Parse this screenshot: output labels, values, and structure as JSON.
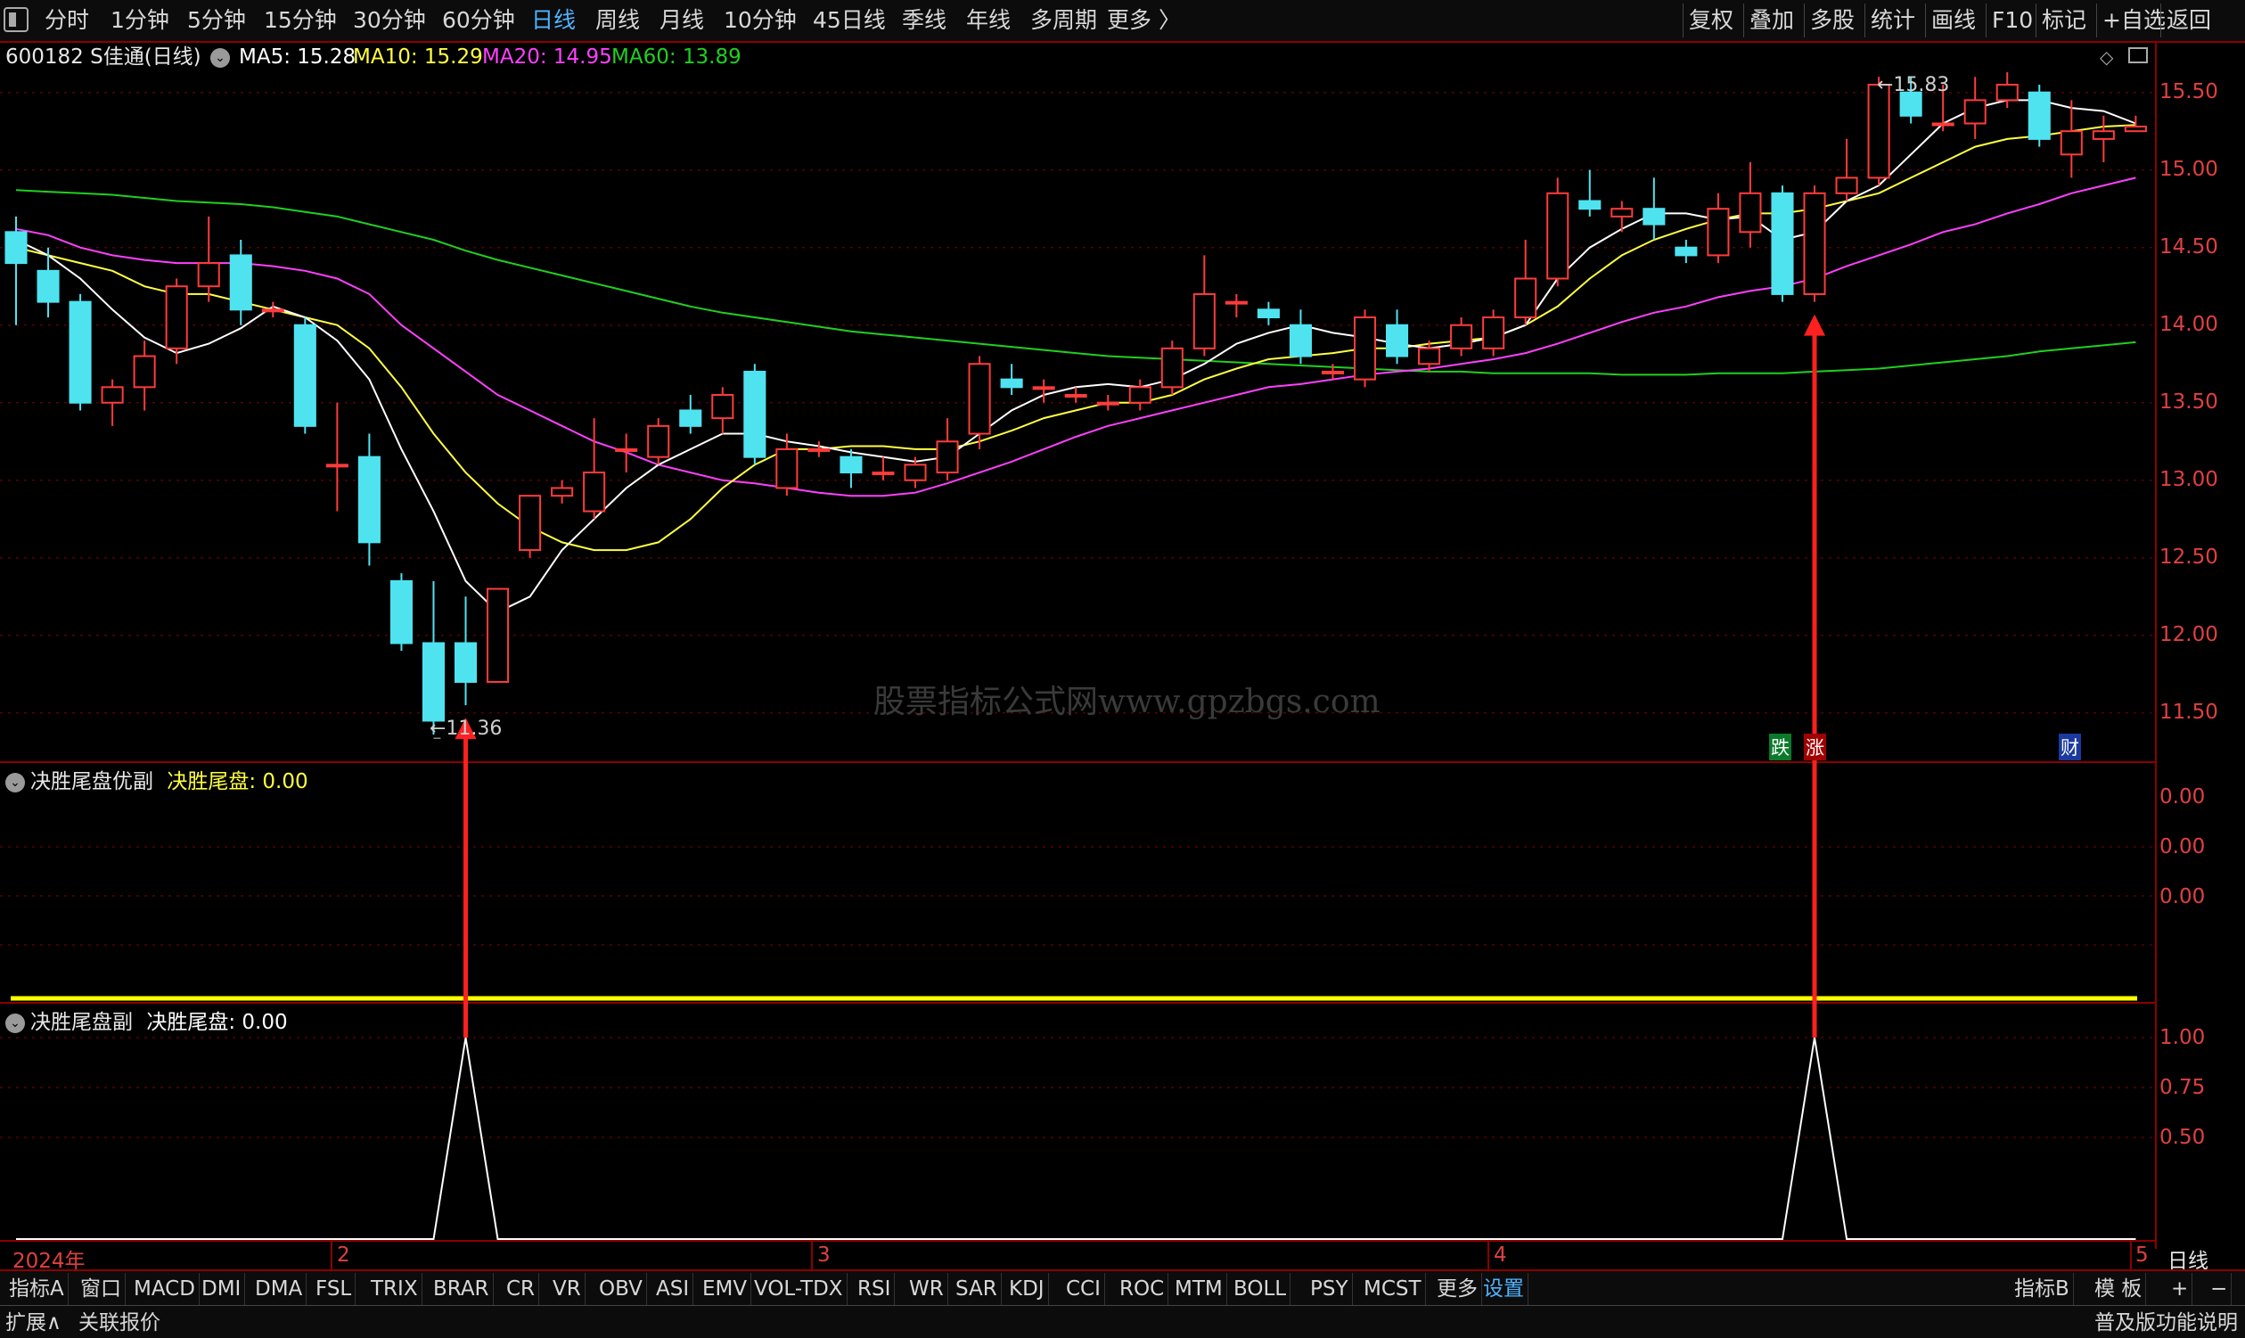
{
  "toolbar": {
    "periods": [
      "分时",
      "1分钟",
      "5分钟",
      "15分钟",
      "30分钟",
      "60分钟",
      "日线",
      "周线",
      "月线",
      "10分钟",
      "45日线",
      "季线",
      "年线",
      "多周期",
      "更多 〉"
    ],
    "active_period": "日线",
    "right_buttons": [
      "复权",
      "叠加",
      "多股",
      "统计",
      "画线",
      "F10",
      "标记",
      "+自选",
      "返回"
    ]
  },
  "stock": {
    "title": "600182 S佳通(日线)",
    "ma5": "MA5: 15.28",
    "ma10": "MA10: 15.29",
    "ma20": "MA20: 14.95",
    "ma60": "MA60: 13.89"
  },
  "colors": {
    "up": "#ff3b3b",
    "down": "#4fe3f0",
    "ma5": "#ffffff",
    "ma10": "#ffff40",
    "ma20": "#ff40ff",
    "ma60": "#20d020",
    "arrow": "#ff2020",
    "axis": "#8b0000",
    "yellow": "#ffff00"
  },
  "price_axis": [
    "15.50",
    "15.00",
    "14.50",
    "14.00",
    "13.50",
    "13.00",
    "12.50",
    "12.00",
    "11.50"
  ],
  "annotations": {
    "low": "←11.36",
    "high": "←15.83",
    "tags": [
      "跌",
      "涨",
      "财"
    ]
  },
  "watermark": "股票指标公式网www.gpzbgs.com",
  "panel1": {
    "title": "决胜尾盘优副",
    "series_label": "决胜尾盘: 0.00",
    "axis": [
      "0.00",
      "0.00",
      "0.00"
    ]
  },
  "panel2": {
    "title": "决胜尾盘副",
    "series_label": "决胜尾盘: 0.00",
    "axis": [
      "1.00",
      "0.75",
      "0.50"
    ]
  },
  "x_axis": {
    "labels": [
      "2024年",
      "2",
      "3",
      "4",
      "5"
    ],
    "period": "日线"
  },
  "tabs": [
    "指标A",
    "窗口",
    "MACD",
    "DMI",
    "DMA",
    "FSL",
    "TRIX",
    "BRAR",
    "CR",
    "VR",
    "OBV",
    "ASI",
    "EMV",
    "VOL-TDX",
    "RSI",
    "WR",
    "SAR",
    "KDJ",
    "CCI",
    "ROC",
    "MTM",
    "BOLL",
    "PSY",
    "MCST",
    "更多",
    "设置"
  ],
  "tabs_active": "设置",
  "tabs_right": [
    "指标B",
    "模 板",
    "+",
    "−"
  ],
  "status": {
    "left": [
      "扩展∧",
      "关联报价"
    ],
    "right": "普及版功能说明"
  },
  "chart_data": {
    "type": "candlestick",
    "candles": [
      [
        14.6,
        14.4,
        14.7,
        14.0
      ],
      [
        14.35,
        14.15,
        14.5,
        14.05
      ],
      [
        14.15,
        13.5,
        14.2,
        13.45
      ],
      [
        13.5,
        13.6,
        13.65,
        13.35
      ],
      [
        13.6,
        13.8,
        13.9,
        13.45
      ],
      [
        13.85,
        14.25,
        14.3,
        13.75
      ],
      [
        14.25,
        14.4,
        14.7,
        14.15
      ],
      [
        14.45,
        14.1,
        14.55,
        14.0
      ],
      [
        14.1,
        14.1,
        14.15,
        14.05
      ],
      [
        14.0,
        13.35,
        14.05,
        13.3
      ],
      [
        13.1,
        13.1,
        13.5,
        12.8
      ],
      [
        13.15,
        12.6,
        13.3,
        12.45
      ],
      [
        12.35,
        11.95,
        12.4,
        11.9
      ],
      [
        11.95,
        11.45,
        12.35,
        11.36
      ],
      [
        11.95,
        11.7,
        12.25,
        11.55
      ],
      [
        11.7,
        12.3,
        12.3,
        11.7
      ],
      [
        12.55,
        12.9,
        12.9,
        12.5
      ],
      [
        12.9,
        12.95,
        13.0,
        12.85
      ],
      [
        12.8,
        13.05,
        13.4,
        12.75
      ],
      [
        13.2,
        13.2,
        13.3,
        13.05
      ],
      [
        13.15,
        13.35,
        13.4,
        13.1
      ],
      [
        13.45,
        13.35,
        13.55,
        13.3
      ],
      [
        13.4,
        13.55,
        13.6,
        13.3
      ],
      [
        13.7,
        13.15,
        13.75,
        13.1
      ],
      [
        12.95,
        13.2,
        13.3,
        12.9
      ],
      [
        13.2,
        13.2,
        13.25,
        13.15
      ],
      [
        13.15,
        13.05,
        13.2,
        12.95
      ],
      [
        13.05,
        13.05,
        13.15,
        13.0
      ],
      [
        13.0,
        13.1,
        13.15,
        12.95
      ],
      [
        13.05,
        13.25,
        13.4,
        13.0
      ],
      [
        13.3,
        13.75,
        13.8,
        13.2
      ],
      [
        13.65,
        13.6,
        13.75,
        13.55
      ],
      [
        13.6,
        13.6,
        13.65,
        13.5
      ],
      [
        13.55,
        13.55,
        13.6,
        13.5
      ],
      [
        13.5,
        13.5,
        13.55,
        13.45
      ],
      [
        13.5,
        13.6,
        13.65,
        13.45
      ],
      [
        13.6,
        13.85,
        13.9,
        13.55
      ],
      [
        13.85,
        14.2,
        14.45,
        13.8
      ],
      [
        14.15,
        14.15,
        14.2,
        14.05
      ],
      [
        14.1,
        14.05,
        14.15,
        14.0
      ],
      [
        14.0,
        13.8,
        14.1,
        13.75
      ],
      [
        13.7,
        13.7,
        13.75,
        13.65
      ],
      [
        13.65,
        14.05,
        14.1,
        13.6
      ],
      [
        14.0,
        13.8,
        14.1,
        13.75
      ],
      [
        13.75,
        13.85,
        13.9,
        13.7
      ],
      [
        13.85,
        14.0,
        14.05,
        13.8
      ],
      [
        13.85,
        14.05,
        14.1,
        13.8
      ],
      [
        14.05,
        14.3,
        14.55,
        14.0
      ],
      [
        14.3,
        14.85,
        14.95,
        14.25
      ],
      [
        14.8,
        14.75,
        15.0,
        14.7
      ],
      [
        14.7,
        14.75,
        14.8,
        14.6
      ],
      [
        14.75,
        14.65,
        14.95,
        14.55
      ],
      [
        14.5,
        14.45,
        14.55,
        14.4
      ],
      [
        14.45,
        14.75,
        14.85,
        14.4
      ],
      [
        14.6,
        14.85,
        15.05,
        14.5
      ],
      [
        14.85,
        14.2,
        14.9,
        14.15
      ],
      [
        14.2,
        14.85,
        14.9,
        14.15
      ],
      [
        14.85,
        14.95,
        15.2,
        14.8
      ],
      [
        14.95,
        15.55,
        15.6,
        14.9
      ],
      [
        15.5,
        15.35,
        15.6,
        15.3
      ],
      [
        15.3,
        15.3,
        15.55,
        15.25
      ],
      [
        15.3,
        15.45,
        15.6,
        15.2
      ],
      [
        15.45,
        15.55,
        15.63,
        15.4
      ],
      [
        15.5,
        15.2,
        15.55,
        15.15
      ],
      [
        15.1,
        15.25,
        15.45,
        14.95
      ],
      [
        15.2,
        15.25,
        15.35,
        15.05
      ],
      [
        15.25,
        15.28,
        15.35,
        15.25
      ]
    ],
    "ma5": [
      14.55,
      14.45,
      14.3,
      14.1,
      13.92,
      13.82,
      13.88,
      13.98,
      14.12,
      14.05,
      13.9,
      13.65,
      13.2,
      12.8,
      12.35,
      12.15,
      12.25,
      12.55,
      12.75,
      12.95,
      13.1,
      13.2,
      13.3,
      13.3,
      13.25,
      13.22,
      13.18,
      13.15,
      13.12,
      13.15,
      13.3,
      13.45,
      13.55,
      13.6,
      13.62,
      13.6,
      13.65,
      13.75,
      13.88,
      13.95,
      14.0,
      13.95,
      13.92,
      13.88,
      13.85,
      13.88,
      13.92,
      14.0,
      14.3,
      14.5,
      14.62,
      14.72,
      14.72,
      14.68,
      14.7,
      14.55,
      14.6,
      14.8,
      14.9,
      15.1,
      15.3,
      15.4,
      15.45,
      15.45,
      15.4,
      15.38,
      15.3
    ],
    "ma10": [
      14.5,
      14.45,
      14.4,
      14.35,
      14.25,
      14.2,
      14.2,
      14.15,
      14.1,
      14.05,
      14.0,
      13.85,
      13.6,
      13.3,
      13.05,
      12.85,
      12.7,
      12.6,
      12.55,
      12.55,
      12.6,
      12.75,
      12.95,
      13.1,
      13.2,
      13.2,
      13.22,
      13.22,
      13.2,
      13.2,
      13.25,
      13.32,
      13.4,
      13.45,
      13.5,
      13.5,
      13.55,
      13.65,
      13.72,
      13.78,
      13.8,
      13.82,
      13.85,
      13.85,
      13.88,
      13.9,
      13.92,
      14.0,
      14.12,
      14.3,
      14.45,
      14.55,
      14.62,
      14.68,
      14.72,
      14.72,
      14.75,
      14.8,
      14.85,
      14.95,
      15.05,
      15.15,
      15.2,
      15.22,
      15.25,
      15.28,
      15.29
    ],
    "ma20": [
      14.62,
      14.58,
      14.5,
      14.45,
      14.42,
      14.4,
      14.4,
      14.4,
      14.38,
      14.35,
      14.3,
      14.2,
      14.0,
      13.85,
      13.7,
      13.55,
      13.45,
      13.35,
      13.25,
      13.18,
      13.1,
      13.05,
      13.0,
      12.98,
      12.95,
      12.92,
      12.9,
      12.9,
      12.92,
      12.98,
      13.05,
      13.12,
      13.2,
      13.28,
      13.35,
      13.4,
      13.45,
      13.5,
      13.55,
      13.6,
      13.62,
      13.65,
      13.68,
      13.7,
      13.72,
      13.75,
      13.78,
      13.82,
      13.88,
      13.95,
      14.02,
      14.08,
      14.12,
      14.18,
      14.22,
      14.25,
      14.3,
      14.38,
      14.45,
      14.52,
      14.6,
      14.65,
      14.72,
      14.78,
      14.85,
      14.9,
      14.95
    ],
    "ma60": [
      14.87,
      14.86,
      14.85,
      14.84,
      14.82,
      14.8,
      14.79,
      14.78,
      14.76,
      14.73,
      14.7,
      14.65,
      14.6,
      14.55,
      14.48,
      14.42,
      14.37,
      14.32,
      14.27,
      14.22,
      14.17,
      14.12,
      14.08,
      14.05,
      14.02,
      13.99,
      13.96,
      13.94,
      13.92,
      13.9,
      13.88,
      13.86,
      13.84,
      13.82,
      13.8,
      13.79,
      13.78,
      13.77,
      13.76,
      13.75,
      13.74,
      13.73,
      13.72,
      13.71,
      13.7,
      13.7,
      13.69,
      13.69,
      13.69,
      13.69,
      13.68,
      13.68,
      13.68,
      13.69,
      13.69,
      13.69,
      13.7,
      13.71,
      13.72,
      13.74,
      13.76,
      13.78,
      13.8,
      13.83,
      13.85,
      13.87,
      13.89
    ],
    "signals": [
      14,
      56
    ],
    "price_range": [
      11.2,
      15.82
    ]
  }
}
